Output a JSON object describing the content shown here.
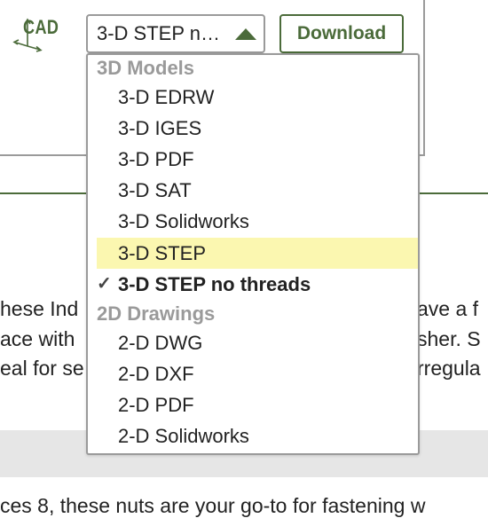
{
  "cad": {
    "label": "CAD",
    "icon": "cad-axes-icon"
  },
  "select": {
    "value": "3-D STEP n…"
  },
  "download": {
    "label": "Download"
  },
  "body_text": {
    "line1_left": "hese Ind",
    "line1_right": "ave a f",
    "line2_left": "ace with",
    "line2_right": "sher. S",
    "line3_left": "eal for se",
    "line3_right": "rregula",
    "line4": "ces 8, these nuts are your go-to for fastening w"
  },
  "dropdown": {
    "groups": [
      {
        "label": "3D Models",
        "options": [
          {
            "label": "3-D EDRW"
          },
          {
            "label": "3-D IGES"
          },
          {
            "label": "3-D PDF"
          },
          {
            "label": "3-D SAT"
          },
          {
            "label": "3-D Solidworks"
          },
          {
            "label": "3-D STEP"
          },
          {
            "label": "3-D STEP no threads"
          }
        ]
      },
      {
        "label": "2D Drawings",
        "options": [
          {
            "label": "2-D DWG"
          },
          {
            "label": "2-D DXF"
          },
          {
            "label": "2-D PDF"
          },
          {
            "label": "2-D Solidworks"
          }
        ]
      }
    ],
    "highlighted": "3-D STEP",
    "selected": "3-D STEP no threads"
  },
  "colors": {
    "accent": "#4b6b3a",
    "highlight": "#fbf7b0",
    "border": "#9a9a9a",
    "band": "#e6e6e6"
  }
}
